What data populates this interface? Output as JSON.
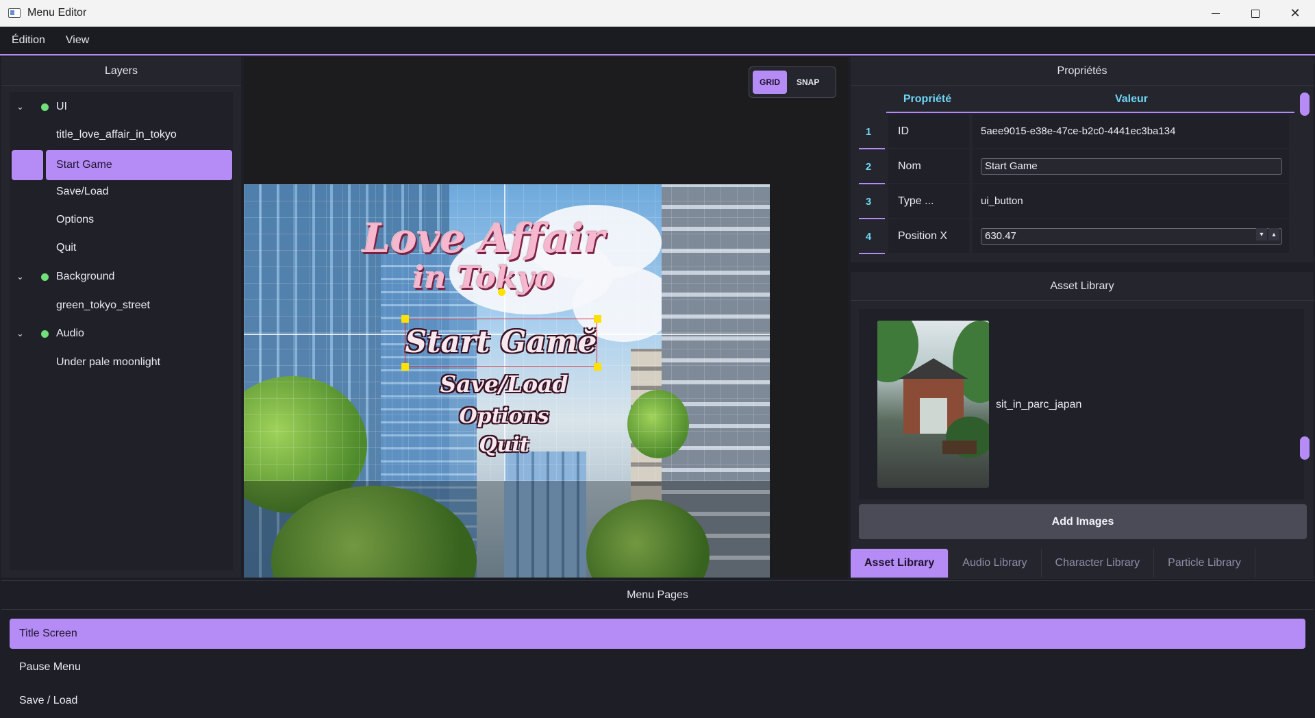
{
  "window": {
    "title": "Menu Editor",
    "controls": [
      "minimize",
      "maximize",
      "close"
    ]
  },
  "menubar": {
    "items": [
      "Édition",
      "View"
    ]
  },
  "layers": {
    "title": "Layers",
    "items": [
      {
        "label": "UI",
        "kind": "group",
        "expanded": true,
        "visible": true
      },
      {
        "label": "title_love_affair_in_tokyo",
        "kind": "child"
      },
      {
        "label": "Start Game",
        "kind": "child",
        "selected": true
      },
      {
        "label": "Save/Load",
        "kind": "child"
      },
      {
        "label": "Options",
        "kind": "child"
      },
      {
        "label": "Quit",
        "kind": "child"
      },
      {
        "label": "Background",
        "kind": "group",
        "expanded": true,
        "visible": true
      },
      {
        "label": "green_tokyo_street",
        "kind": "child"
      },
      {
        "label": "Audio",
        "kind": "group",
        "expanded": true,
        "visible": true
      },
      {
        "label": "Under pale moonlight",
        "kind": "child"
      }
    ]
  },
  "canvas": {
    "toggles": [
      {
        "label": "GRID",
        "active": true
      },
      {
        "label": "SNAP",
        "active": false
      }
    ],
    "game": {
      "title_line1": "Love Affair",
      "title_line2": "in Tokyo",
      "menu": [
        "Start Gamĕ",
        "Save/Load",
        "Options",
        "Quit"
      ]
    }
  },
  "properties": {
    "title": "Propriétés",
    "columns": [
      "Propriété",
      "Valeur"
    ],
    "rows": [
      {
        "num": "1",
        "key": "ID",
        "value": "5aee9015-e38e-47ce-b2c0-4441ec3ba134",
        "editor": "text"
      },
      {
        "num": "2",
        "key": "Nom",
        "value": "Start Game",
        "editor": "field"
      },
      {
        "num": "3",
        "key": "Type ...",
        "value": "ui_button",
        "editor": "text"
      },
      {
        "num": "4",
        "key": "Position X",
        "value": "630.47",
        "editor": "spin"
      }
    ]
  },
  "asset_library": {
    "title": "Asset Library",
    "assets": [
      {
        "name": "sit_in_parc_japan"
      }
    ],
    "add_button": "Add Images",
    "tabs": [
      {
        "label": "Asset Library",
        "active": true
      },
      {
        "label": "Audio Library",
        "active": false
      },
      {
        "label": "Character Library",
        "active": false
      },
      {
        "label": "Particle Library",
        "active": false
      }
    ]
  },
  "menu_pages": {
    "title": "Menu Pages",
    "items": [
      {
        "label": "Title Screen",
        "selected": true
      },
      {
        "label": "Pause Menu",
        "selected": false
      },
      {
        "label": "Save / Load",
        "selected": false
      }
    ]
  },
  "colors": {
    "accent": "#b58cf5",
    "header_text": "#6fd6f5",
    "visible_dot": "#72e07a",
    "panel_bg": "#24252d",
    "window_bg": "#1e1f26"
  }
}
